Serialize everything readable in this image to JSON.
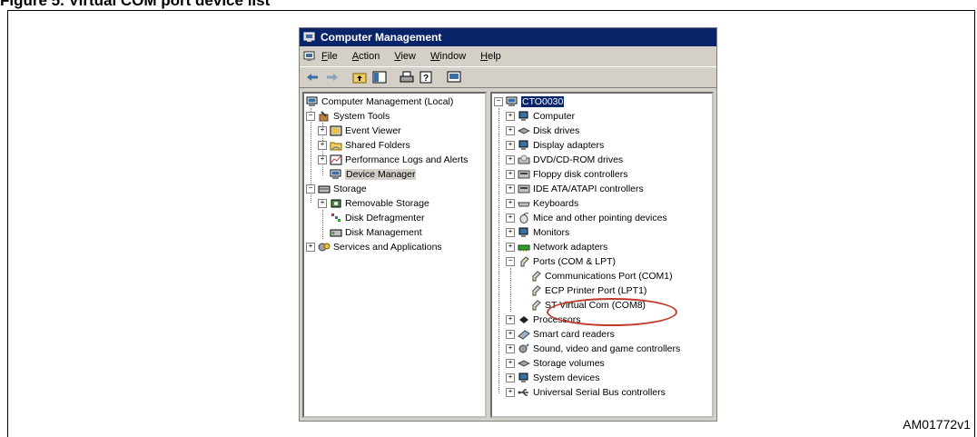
{
  "figure": {
    "caption": "Figure 5. Virtual COM port device list",
    "id": "AM01772v1"
  },
  "window": {
    "title": "Computer Management",
    "menu": [
      {
        "label": "File"
      },
      {
        "label": "Action"
      },
      {
        "label": "View"
      },
      {
        "label": "Window"
      },
      {
        "label": "Help"
      }
    ],
    "toolbar_icons": [
      "back-arrow-icon",
      "forward-arrow-icon",
      "up-folder-icon",
      "show-hide-tree-icon",
      "print-icon",
      "help-icon",
      "console-icon"
    ]
  },
  "left_tree": [
    {
      "label": "Computer Management (Local)",
      "icon": "computer-icon"
    },
    {
      "label": "System Tools",
      "icon": "tools-icon"
    },
    {
      "label": "Event Viewer",
      "icon": "event-viewer-icon"
    },
    {
      "label": "Shared Folders",
      "icon": "shared-folder-icon"
    },
    {
      "label": "Performance Logs and Alerts",
      "icon": "performance-icon"
    },
    {
      "label": "Device Manager",
      "icon": "device-manager-icon"
    },
    {
      "label": "Storage",
      "icon": "storage-icon"
    },
    {
      "label": "Removable Storage",
      "icon": "removable-storage-icon"
    },
    {
      "label": "Disk Defragmenter",
      "icon": "defrag-icon"
    },
    {
      "label": "Disk Management",
      "icon": "disk-management-icon"
    },
    {
      "label": "Services and Applications",
      "icon": "services-icon"
    }
  ],
  "right_tree": [
    {
      "label": "CTO0030",
      "icon": "computer-icon"
    },
    {
      "label": "Computer",
      "icon": "computer-icon"
    },
    {
      "label": "Disk drives",
      "icon": "disk-drive-icon"
    },
    {
      "label": "Display adapters",
      "icon": "display-adapter-icon"
    },
    {
      "label": "DVD/CD-ROM drives",
      "icon": "cdrom-icon"
    },
    {
      "label": "Floppy disk controllers",
      "icon": "floppy-controller-icon"
    },
    {
      "label": "IDE ATA/ATAPI controllers",
      "icon": "ide-controller-icon"
    },
    {
      "label": "Keyboards",
      "icon": "keyboard-icon"
    },
    {
      "label": "Mice and other pointing devices",
      "icon": "mouse-icon"
    },
    {
      "label": "Monitors",
      "icon": "monitor-icon"
    },
    {
      "label": "Network adapters",
      "icon": "network-adapter-icon"
    },
    {
      "label": "Ports (COM & LPT)",
      "icon": "port-icon"
    },
    {
      "label": "Communications Port (COM1)",
      "icon": "port-icon"
    },
    {
      "label": "ECP Printer Port (LPT1)",
      "icon": "port-icon"
    },
    {
      "label": "ST Virtual Com (COM8)",
      "icon": "port-icon"
    },
    {
      "label": "Processors",
      "icon": "processor-icon"
    },
    {
      "label": "Smart card readers",
      "icon": "smart-card-icon"
    },
    {
      "label": "Sound, video and game controllers",
      "icon": "sound-icon"
    },
    {
      "label": "Storage volumes",
      "icon": "storage-volume-icon"
    },
    {
      "label": "System devices",
      "icon": "system-devices-icon"
    },
    {
      "label": "Universal Serial Bus controllers",
      "icon": "usb-icon"
    }
  ],
  "colors": {
    "titlebar": "#0a246a",
    "selection": "#0a246a",
    "window_face": "#d4d0c8",
    "highlight_circle": "#c0392b"
  }
}
